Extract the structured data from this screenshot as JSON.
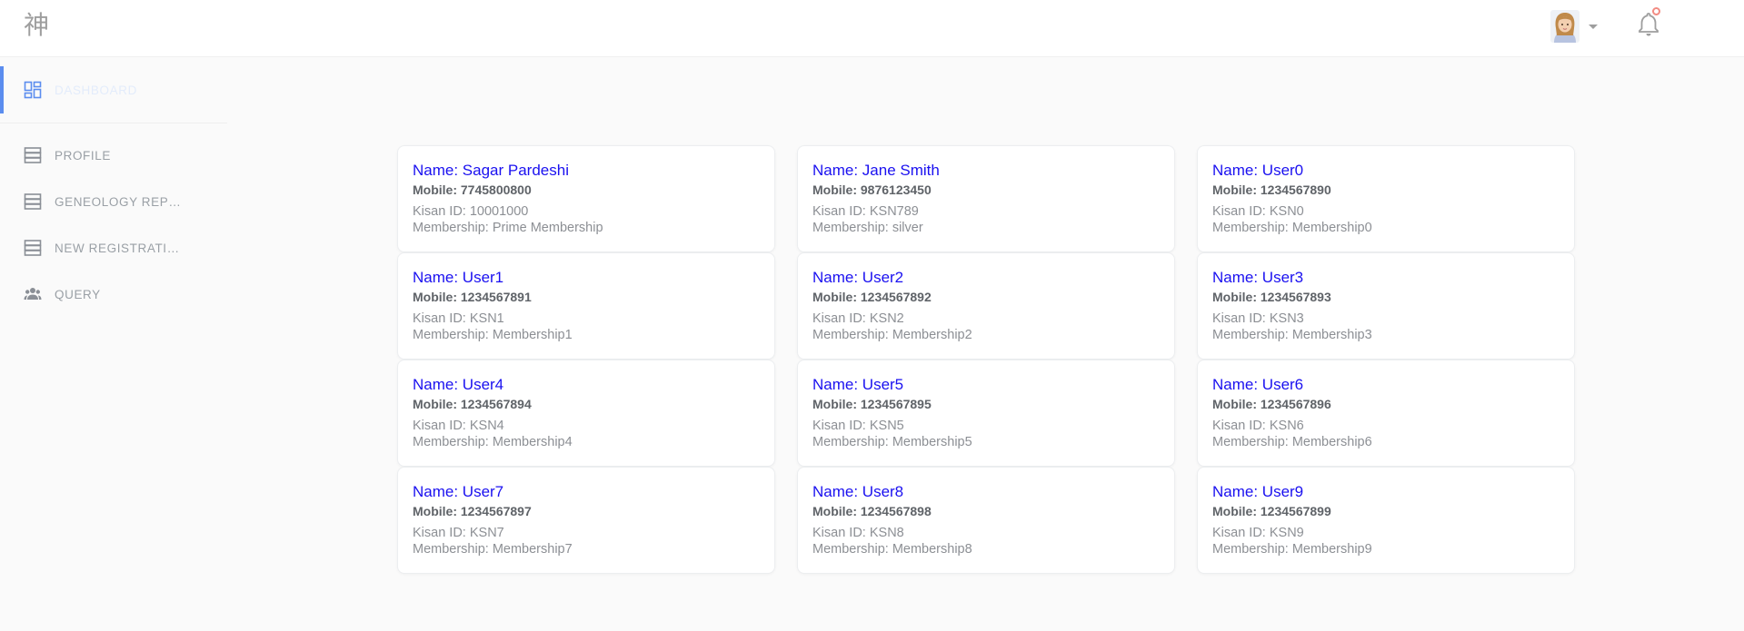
{
  "header": {
    "logo_text": "神",
    "avatar_icon": "user-avatar",
    "dropdown_icon": "caret-down-icon",
    "notification_icon": "bell-icon",
    "notification_badge_color": "#f28b82"
  },
  "sidebar": {
    "items": [
      {
        "label": "Dashboard",
        "icon": "dashboard-icon",
        "active": true
      },
      {
        "label": "PROFILE",
        "icon": "list-icon"
      },
      {
        "label": "GENEOLOGY REP…",
        "icon": "list-icon"
      },
      {
        "label": "NEW REGISTRATI…",
        "icon": "list-icon"
      },
      {
        "label": "QUERY",
        "icon": "people-icon"
      }
    ],
    "accent_color": "#5b8def"
  },
  "users": [
    {
      "name": "Name: Sagar Pardeshi",
      "mobile": "Mobile: 7745800800",
      "kisan_id": "Kisan ID: 10001000",
      "membership": "Membership: Prime Membership"
    },
    {
      "name": "Name: Jane Smith",
      "mobile": "Mobile: 9876123450",
      "kisan_id": "Kisan ID: KSN789",
      "membership": "Membership: silver"
    },
    {
      "name": "Name: User0",
      "mobile": "Mobile: 1234567890",
      "kisan_id": "Kisan ID: KSN0",
      "membership": "Membership: Membership0"
    },
    {
      "name": "Name: User1",
      "mobile": "Mobile: 1234567891",
      "kisan_id": "Kisan ID: KSN1",
      "membership": "Membership: Membership1"
    },
    {
      "name": "Name: User2",
      "mobile": "Mobile: 1234567892",
      "kisan_id": "Kisan ID: KSN2",
      "membership": "Membership: Membership2"
    },
    {
      "name": "Name: User3",
      "mobile": "Mobile: 1234567893",
      "kisan_id": "Kisan ID: KSN3",
      "membership": "Membership: Membership3"
    },
    {
      "name": "Name: User4",
      "mobile": "Mobile: 1234567894",
      "kisan_id": "Kisan ID: KSN4",
      "membership": "Membership: Membership4"
    },
    {
      "name": "Name: User5",
      "mobile": "Mobile: 1234567895",
      "kisan_id": "Kisan ID: KSN5",
      "membership": "Membership: Membership5"
    },
    {
      "name": "Name: User6",
      "mobile": "Mobile: 1234567896",
      "kisan_id": "Kisan ID: KSN6",
      "membership": "Membership: Membership6"
    },
    {
      "name": "Name: User7",
      "mobile": "Mobile: 1234567897",
      "kisan_id": "Kisan ID: KSN7",
      "membership": "Membership: Membership7"
    },
    {
      "name": "Name: User8",
      "mobile": "Mobile: 1234567898",
      "kisan_id": "Kisan ID: KSN8",
      "membership": "Membership: Membership8"
    },
    {
      "name": "Name: User9",
      "mobile": "Mobile: 1234567899",
      "kisan_id": "Kisan ID: KSN9",
      "membership": "Membership: Membership9"
    }
  ],
  "colors": {
    "name_text": "#1a10f0",
    "background": "#fafafa"
  }
}
